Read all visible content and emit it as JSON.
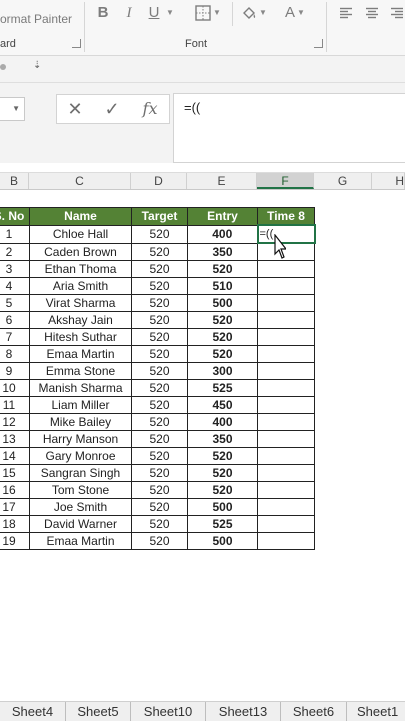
{
  "ribbon": {
    "format_painter": "ormat Painter",
    "clipboard_group": "ard",
    "font_group": "Font",
    "bold": "B",
    "italic": "I",
    "underline": "U",
    "font_color_icon": "A"
  },
  "formula_bar": {
    "cancel_icon": "✕",
    "enter_icon": "✓",
    "fx": "fx",
    "content": "=(("
  },
  "columns": [
    "B",
    "C",
    "D",
    "E",
    "F",
    "G",
    "H"
  ],
  "table": {
    "headers": [
      "S. No",
      "Name",
      "Target",
      "Entry",
      "Time 8"
    ],
    "active_cell_text": "=((",
    "rows": [
      {
        "no": "1",
        "name": "Chloe Hall",
        "target": "520",
        "entry": "400"
      },
      {
        "no": "2",
        "name": "Caden Brown",
        "target": "520",
        "entry": "350"
      },
      {
        "no": "3",
        "name": "Ethan Thoma",
        "target": "520",
        "entry": "520"
      },
      {
        "no": "4",
        "name": "Aria Smith",
        "target": "520",
        "entry": "510"
      },
      {
        "no": "5",
        "name": "Virat Sharma",
        "target": "520",
        "entry": "500"
      },
      {
        "no": "6",
        "name": "Akshay Jain",
        "target": "520",
        "entry": "520"
      },
      {
        "no": "7",
        "name": "Hitesh Suthar",
        "target": "520",
        "entry": "520"
      },
      {
        "no": "8",
        "name": "Emaa Martin",
        "target": "520",
        "entry": "520"
      },
      {
        "no": "9",
        "name": "Emma Stone",
        "target": "520",
        "entry": "300"
      },
      {
        "no": "10",
        "name": "Manish Sharma",
        "target": "520",
        "entry": "525"
      },
      {
        "no": "11",
        "name": "Liam Miller",
        "target": "520",
        "entry": "450"
      },
      {
        "no": "12",
        "name": "Mike Bailey",
        "target": "520",
        "entry": "400"
      },
      {
        "no": "13",
        "name": "Harry Manson",
        "target": "520",
        "entry": "350"
      },
      {
        "no": "14",
        "name": "Gary Monroe",
        "target": "520",
        "entry": "520"
      },
      {
        "no": "15",
        "name": "Sangran Singh",
        "target": "520",
        "entry": "520"
      },
      {
        "no": "16",
        "name": "Tom Stone",
        "target": "520",
        "entry": "520"
      },
      {
        "no": "17",
        "name": "Joe Smith",
        "target": "520",
        "entry": "500"
      },
      {
        "no": "18",
        "name": "David Warner",
        "target": "520",
        "entry": "525"
      },
      {
        "no": "19",
        "name": "Emaa Martin",
        "target": "520",
        "entry": "500"
      }
    ]
  },
  "sheet_tabs": [
    "Sheet4",
    "Sheet5",
    "Sheet10",
    "Sheet13",
    "Sheet6",
    "Sheet1"
  ],
  "colors": {
    "header_fill": "#548235",
    "accent": "#217346"
  }
}
